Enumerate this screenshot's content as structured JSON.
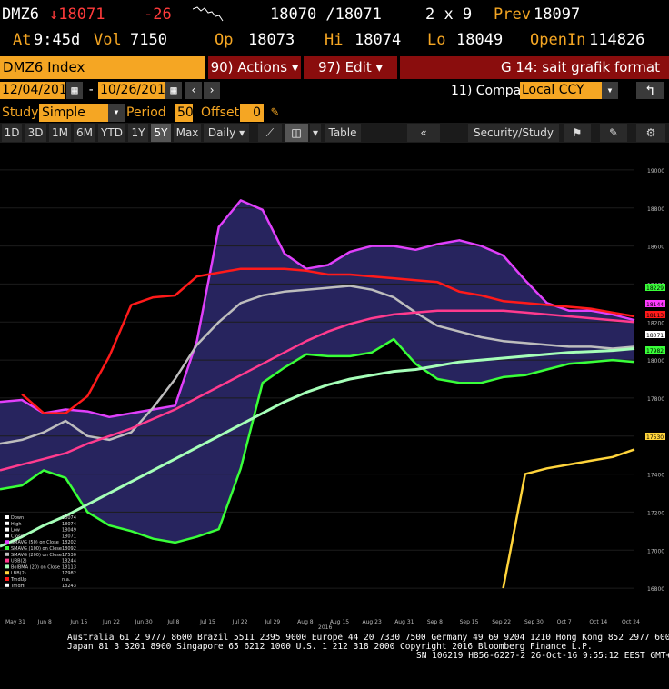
{
  "quote": {
    "ticker": "DMZ6",
    "last_price": "18071",
    "change": "-26",
    "bid_ask": "18070 /18071",
    "size": "2 x 9",
    "prev_label": "Prev",
    "prev_value": "18097",
    "time_label": "At",
    "time_value": "9:45d",
    "vol_label": "Vol",
    "vol_value": "7150",
    "open_label": "Op",
    "open_value": "18073",
    "high_label": "Hi",
    "high_value": "18074",
    "low_label": "Lo",
    "low_value": "18049",
    "oi_label": "OpenIn",
    "oi_value": "114826"
  },
  "command_bar": {
    "security": "DMZ6 Index",
    "actions": "90) Actions",
    "edit": "97) Edit",
    "function_title": "G 14: sait grafik format"
  },
  "date_bar": {
    "start_date": "12/04/2015",
    "end_date": "10/26/2016",
    "separator": "-",
    "compare_label": "11) Compare",
    "compare_value": "Local CCY"
  },
  "study_bar": {
    "study_label": "Study",
    "study_value": "Simple MA",
    "period_label": "Period",
    "period_value": "50",
    "offset_label": "Offset",
    "offset_value": "0"
  },
  "range_bar": {
    "ranges": [
      "1D",
      "3D",
      "1M",
      "6M",
      "YTD",
      "1Y",
      "5Y",
      "Max"
    ],
    "selected": "5Y",
    "frequency": "Daily",
    "table_label": "Table",
    "security_study": "Security/Study"
  },
  "chart_data": {
    "type": "line",
    "y_ticks": [
      19000,
      18800,
      18600,
      18400,
      18200,
      18000,
      17800,
      17600,
      17400,
      17200,
      17000,
      16800
    ],
    "x_ticks": [
      "May 31",
      "Jun 8",
      "Jun 15",
      "Jun 22",
      "Jun 30",
      "Jul 8",
      "Jul 15",
      "Jul 22",
      "Jul 29",
      "Aug 8",
      "Aug 15",
      "Aug 23",
      "Aug 31",
      "Sep 8",
      "Sep 15",
      "Sep 22",
      "Sep 30",
      "Oct 7",
      "Oct 14",
      "Oct 24"
    ],
    "x_year": "2016",
    "ylim": [
      16700,
      19100
    ],
    "last_value_labels": [
      {
        "value": "18229",
        "color": "#39ff39"
      },
      {
        "value": "18144",
        "color": "#ff3bff"
      },
      {
        "value": "18113",
        "color": "#ff1a1a"
      },
      {
        "value": "18071",
        "color": "#ffffff"
      },
      {
        "value": "17982",
        "color": "#39ff39"
      },
      {
        "value": "17530",
        "color": "#ffd43b"
      }
    ],
    "series": [
      {
        "name": "BB Upper",
        "color": "#e040fb",
        "values": [
          17780,
          17790,
          17720,
          17740,
          17730,
          17700,
          17720,
          17740,
          17760,
          18100,
          18700,
          18840,
          18790,
          18560,
          18480,
          18500,
          18570,
          18600,
          18600,
          18580,
          18610,
          18630,
          18600,
          18550,
          18420,
          18300,
          18260,
          18260,
          18240,
          18210
        ]
      },
      {
        "name": "BB Lower",
        "color": "#39ff39",
        "values": [
          17320,
          17340,
          17420,
          17380,
          17200,
          17130,
          17100,
          17060,
          17040,
          17070,
          17110,
          17430,
          17880,
          17960,
          18030,
          18020,
          18020,
          18040,
          18110,
          17980,
          17900,
          17880,
          17880,
          17910,
          17920,
          17950,
          17980,
          17990,
          18000,
          17990
        ]
      },
      {
        "name": "SMAVG (50)",
        "color": "#bdbdbd",
        "values": [
          17560,
          17580,
          17620,
          17680,
          17600,
          17580,
          17620,
          17750,
          17900,
          18080,
          18200,
          18300,
          18340,
          18360,
          18370,
          18380,
          18390,
          18370,
          18330,
          18250,
          18180,
          18150,
          18120,
          18100,
          18090,
          18080,
          18070,
          18070,
          18060,
          18070
        ]
      },
      {
        "name": "SMAVG (100)",
        "color": "#ff3b8e",
        "values": [
          17420,
          17450,
          17480,
          17510,
          17560,
          17600,
          17640,
          17690,
          17740,
          17800,
          17860,
          17920,
          17980,
          18040,
          18100,
          18150,
          18190,
          18220,
          18240,
          18250,
          18260,
          18260,
          18260,
          18260,
          18250,
          18240,
          18230,
          18220,
          18210,
          18200
        ]
      },
      {
        "name": "SMAVG (200)",
        "color": "#a5ffb8",
        "values": [
          17020,
          17070,
          17130,
          17180,
          17240,
          17300,
          17360,
          17420,
          17480,
          17540,
          17600,
          17660,
          17720,
          17780,
          17830,
          17870,
          17900,
          17920,
          17940,
          17950,
          17970,
          17990,
          18000,
          18010,
          18020,
          18030,
          18040,
          18045,
          18050,
          18060
        ]
      },
      {
        "name": "TrendLine",
        "color": "#ffd43b",
        "values": [
          null,
          null,
          null,
          null,
          null,
          null,
          null,
          null,
          null,
          null,
          null,
          null,
          null,
          null,
          null,
          null,
          null,
          null,
          null,
          null,
          null,
          null,
          null,
          16800,
          17400,
          17430,
          17450,
          17470,
          17490,
          17530
        ]
      },
      {
        "name": "Trend High",
        "color": "#ff1a1a",
        "values": [
          null,
          17820,
          17720,
          17720,
          17810,
          18020,
          18290,
          18330,
          18340,
          18440,
          18460,
          18480,
          18480,
          18480,
          18470,
          18450,
          18450,
          18440,
          18430,
          18420,
          18410,
          18360,
          18340,
          18310,
          18300,
          18290,
          18280,
          18270,
          18250,
          18230
        ]
      }
    ],
    "legend": [
      {
        "label": "Down",
        "value": "18074"
      },
      {
        "label": "High",
        "value": "18074"
      },
      {
        "label": "Low",
        "value": "18049"
      },
      {
        "label": "Close",
        "value": "18071"
      },
      {
        "label": "SMAVG (50) on Close",
        "value": "18202"
      },
      {
        "label": "SMAVG (100) on Close",
        "value": "18092"
      },
      {
        "label": "SMAVG (200) on Close",
        "value": "17530"
      },
      {
        "label": "UBB(2)",
        "value": "18244"
      },
      {
        "label": "BolBMA (20) on Close",
        "value": "18113"
      },
      {
        "label": "LBB(2)",
        "value": "17982"
      },
      {
        "label": "TrndUp",
        "value": "n.a."
      },
      {
        "label": "TrndHi",
        "value": "18243"
      }
    ],
    "legend_placement": "bottom-left"
  },
  "footer": {
    "line1": "Australia 61 2 9777 8600 Brazil 5511 2395 9000 Europe 44 20 7330 7500 Germany 49 69 9204 1210 Hong Kong 852 2977 6000",
    "line2": "Japan 81 3 3201 8900        Singapore 65 6212 1000       U.S. 1 212 318 2000         Copyright 2016 Bloomberg Finance L.P.",
    "line3": "SN 106219 H856-6227-2 26-Oct-16  9:55:12 EEST GMT+3:00"
  }
}
